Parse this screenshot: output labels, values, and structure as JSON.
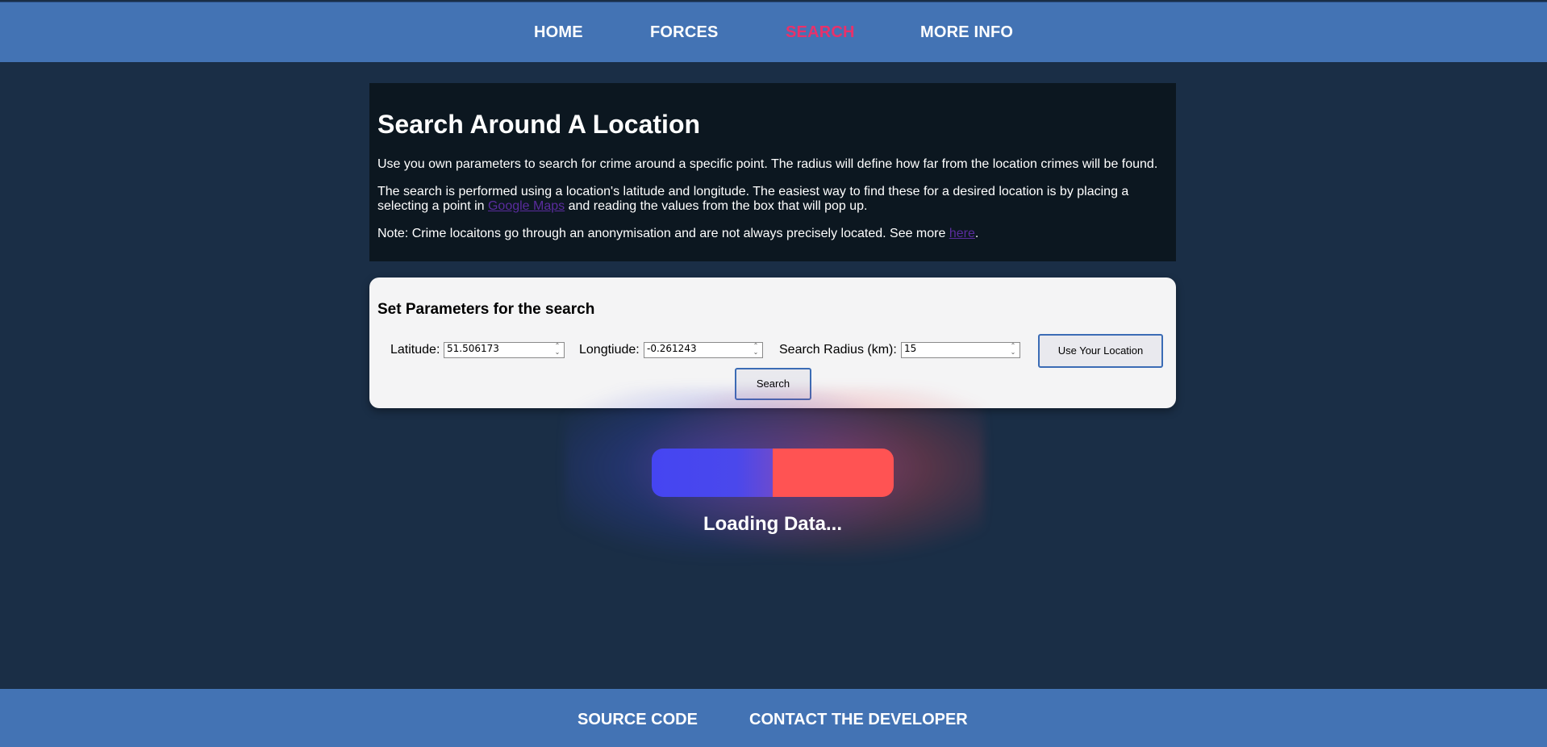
{
  "nav": {
    "home": "HOME",
    "forces": "FORCES",
    "search": "SEARCH",
    "more_info": "MORE INFO"
  },
  "intro": {
    "title": "Search Around A Location",
    "p1": "Use you own parameters to search for crime around a specific point. The radius will define how far from the location crimes will be found.",
    "p2_before": "The search is performed using a location's latitude and longitude. The easiest way to find these for a desired location is by placing a selecting a point in ",
    "p2_link": "Google Maps",
    "p2_after": " and reading the values from the box that will pop up.",
    "p3_before": "Note: Crime locaitons go through an anonymisation and are not always precisely located. See more ",
    "p3_link": "here",
    "p3_after": "."
  },
  "params": {
    "title": "Set Parameters for the search",
    "latitude_label": "Latitude:",
    "latitude_value": "51.506173",
    "longitude_label": "Longtiude:",
    "longitude_value": "-0.261243",
    "radius_label": "Search Radius (km):",
    "radius_value": "15",
    "use_location_label": "Use Your Location",
    "search_label": "Search"
  },
  "loader": {
    "text": "Loading Data...",
    "progress": 0.5
  },
  "footer": {
    "source_code": "SOURCE CODE",
    "contact": "CONTACT THE DEVELOPER"
  },
  "colors": {
    "nav_bg": "#4373b4",
    "page_bg": "#1a2e46",
    "active_nav": "#e9316a",
    "loader_blue": "#4545f2",
    "loader_red": "#ff5353"
  }
}
